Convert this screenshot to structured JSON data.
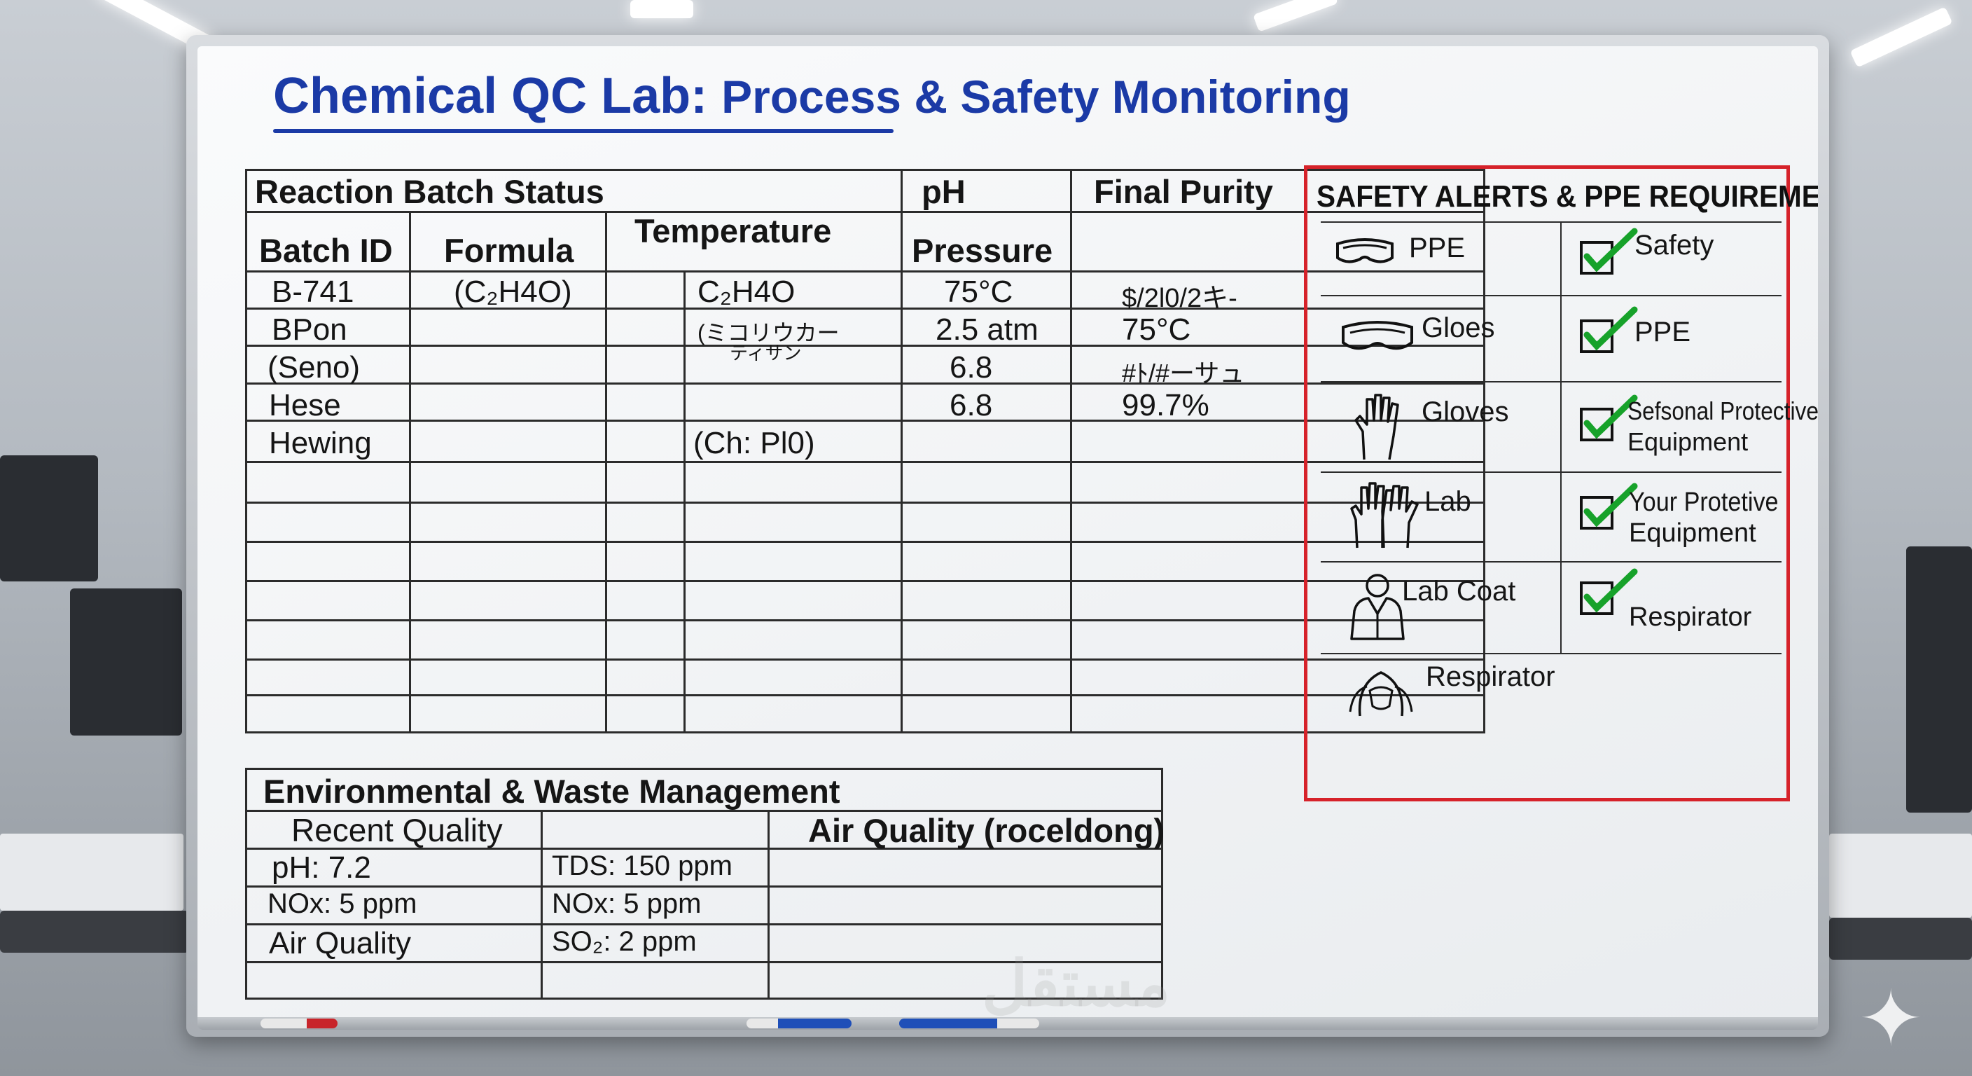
{
  "title": {
    "main": "Chemical QC Lab:",
    "sub": "Process & Safety Monitoring"
  },
  "batch_table": {
    "section_title": "Reaction Batch Status",
    "top_headers": [
      "pH",
      "Final Purity"
    ],
    "headers": [
      "Batch ID",
      "Formula",
      "Temperature",
      "Pressure"
    ],
    "rows": [
      {
        "batch": "B-741",
        "formula": "(C₂H4O)",
        "temp": "C₂H4O",
        "ph": "75°C",
        "purity": "$/2l0/2キ-"
      },
      {
        "batch": "BPon",
        "formula": "",
        "temp": "(ミコリウカー",
        "temp2": "ティサン",
        "ph": "2.5 atm",
        "purity": "75°C"
      },
      {
        "batch": "(Seno)",
        "formula": "",
        "temp": "",
        "ph": "6.8",
        "purity": "#ﾄ/#ーサュ"
      },
      {
        "batch": "Hese",
        "formula": "",
        "temp": "",
        "ph": "6.8",
        "purity": "99.7%"
      },
      {
        "batch": "Hewing",
        "formula": "",
        "temp": "(Ch: Pl0)",
        "ph": "",
        "purity": ""
      }
    ]
  },
  "safety": {
    "title": "SAFETY ALERTS & PPE REQUIREMENTS",
    "items": [
      {
        "icon": "goggles-icon",
        "label": "PPE",
        "check_label": "Safety",
        "check_label2": ""
      },
      {
        "icon": "goggles-icon",
        "label": "Gloes",
        "check_label": "PPE",
        "check_label2": ""
      },
      {
        "icon": "glove-icon",
        "label": "Gloves",
        "check_label": "Sefsonal Protective",
        "check_label2": "Equipment"
      },
      {
        "icon": "gloves-pair-icon",
        "label": "Lab",
        "check_label": "Your Protetive",
        "check_label2": "Equipment"
      },
      {
        "icon": "lab-coat-icon",
        "label": "Lab Coat",
        "check_label": "Respirator",
        "check_label2": ""
      },
      {
        "icon": "respirator-icon",
        "label": "Respirator"
      }
    ],
    "check_color": "#17a22a",
    "border_color": "#d6222a"
  },
  "env_table": {
    "section_title": "Environmental & Waste Management",
    "headers": [
      "Recent Quality",
      "",
      "Air Quality (roceldong)"
    ],
    "rows": [
      [
        "pH: 7.2",
        "TDS: 150 ppm",
        ""
      ],
      [
        "NOx: 5 ppm",
        "NOx: 5 ppm",
        ""
      ],
      [
        "Air Quality",
        "SO₂: 2 ppm",
        ""
      ]
    ]
  },
  "colors": {
    "title": "#1b3aa6",
    "ink": "#151515"
  }
}
